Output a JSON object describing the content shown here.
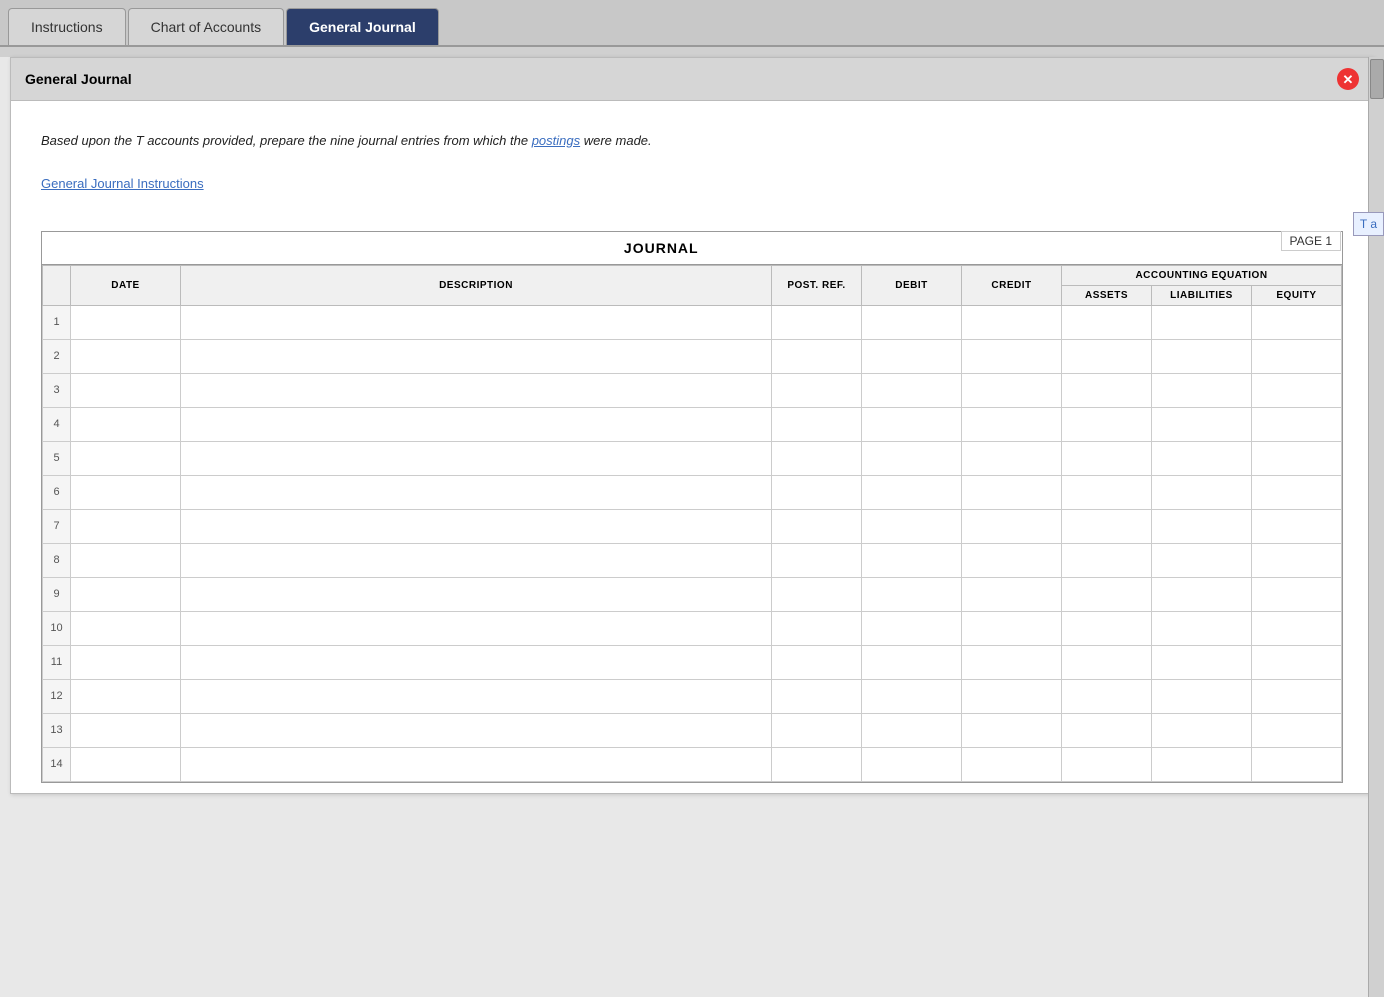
{
  "tabs": [
    {
      "id": "instructions",
      "label": "Instructions",
      "active": false
    },
    {
      "id": "chart-of-accounts",
      "label": "Chart of Accounts",
      "active": false
    },
    {
      "id": "general-journal",
      "label": "General Journal",
      "active": true
    }
  ],
  "panel": {
    "title": "General Journal",
    "close_label": "✕"
  },
  "instruction": {
    "text_before": "Based upon the T accounts provided, prepare the nine journal entries from which the ",
    "link_text": "postings",
    "text_after": " were made.",
    "instructions_link": "General Journal Instructions"
  },
  "page_label": "PAGE 1",
  "journal": {
    "title": "JOURNAL",
    "headers": {
      "row_num": "",
      "date": "DATE",
      "description": "DESCRIPTION",
      "post_ref": "POST. REF.",
      "debit": "DEBIT",
      "credit": "CREDIT",
      "accounting_equation": "ACCOUNTING EQUATION",
      "assets": "ASSETS",
      "liabilities": "LIABILITIES",
      "equity": "EQUITY"
    },
    "rows": [
      1,
      2,
      3,
      4,
      5,
      6,
      7,
      8,
      9,
      10,
      11,
      12,
      13,
      14
    ]
  },
  "right_hint": "T a"
}
